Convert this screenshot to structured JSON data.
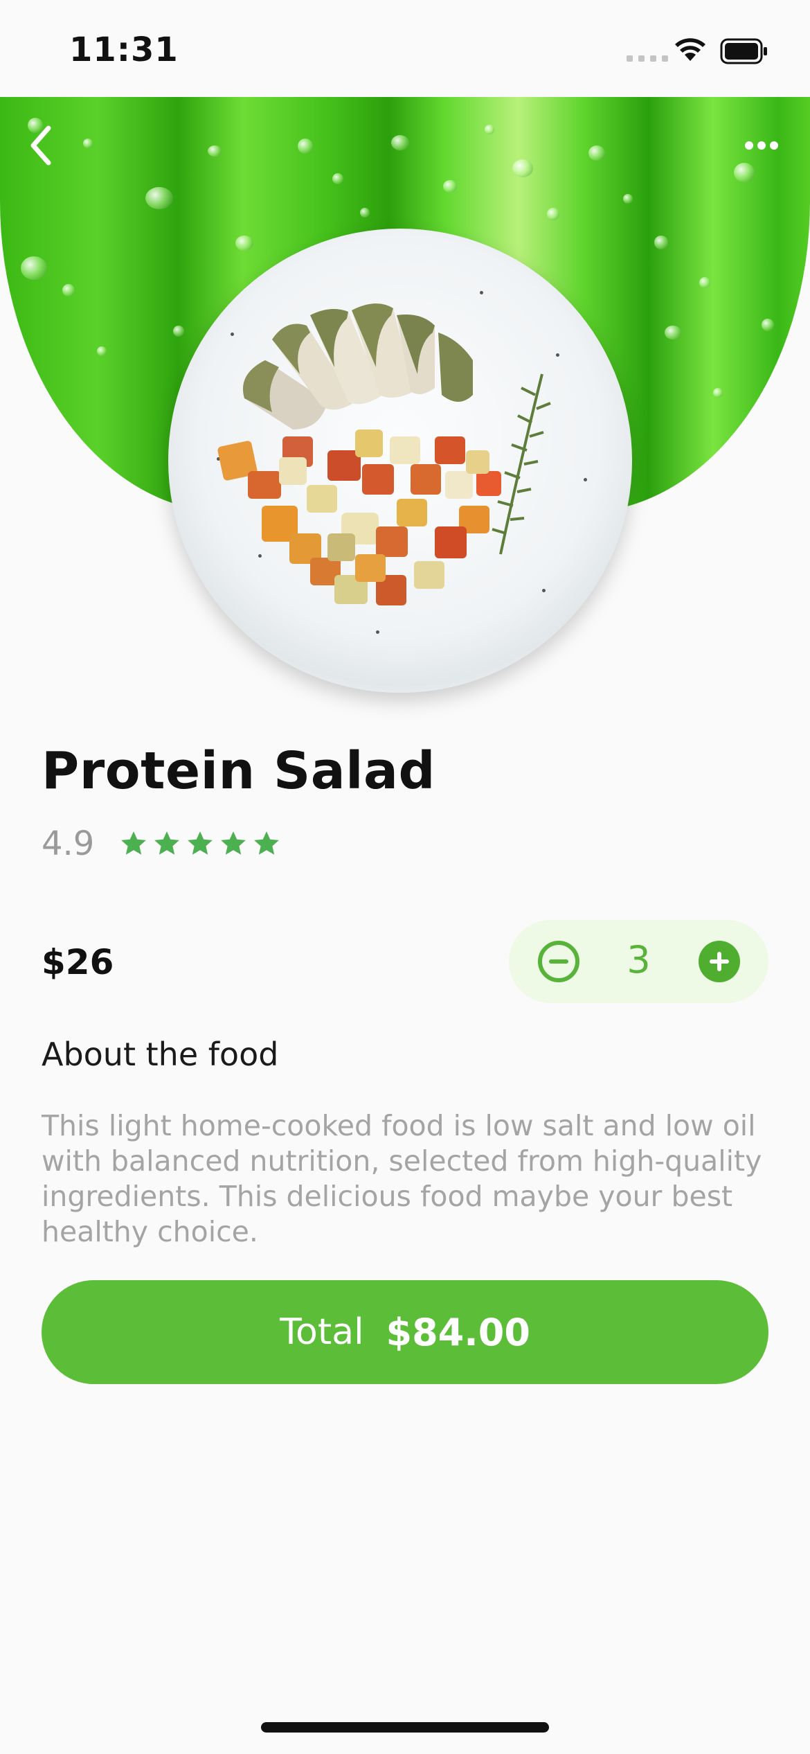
{
  "status_bar": {
    "time": "11:31",
    "icons": [
      "cellular-signal-icon",
      "wifi-icon",
      "battery-icon"
    ]
  },
  "header": {
    "back_icon": "chevron-left-icon",
    "more_icon": "more-horizontal-icon"
  },
  "product": {
    "title": "Protein Salad",
    "rating": "4.9",
    "stars": 5,
    "price": "$26",
    "quantity": "3"
  },
  "about": {
    "heading": "About the food",
    "description": "This light home-cooked food is low salt and low oil with balanced nutrition, selected from high-quality ingredients. This delicious food maybe your best healthy choice."
  },
  "checkout": {
    "total_label": "Total",
    "total_value": "$84.00"
  },
  "colors": {
    "accent": "#5cbe38",
    "star": "#4caf50",
    "stepper_bg": "#eef9e6",
    "muted_text": "#a4a4a4"
  }
}
